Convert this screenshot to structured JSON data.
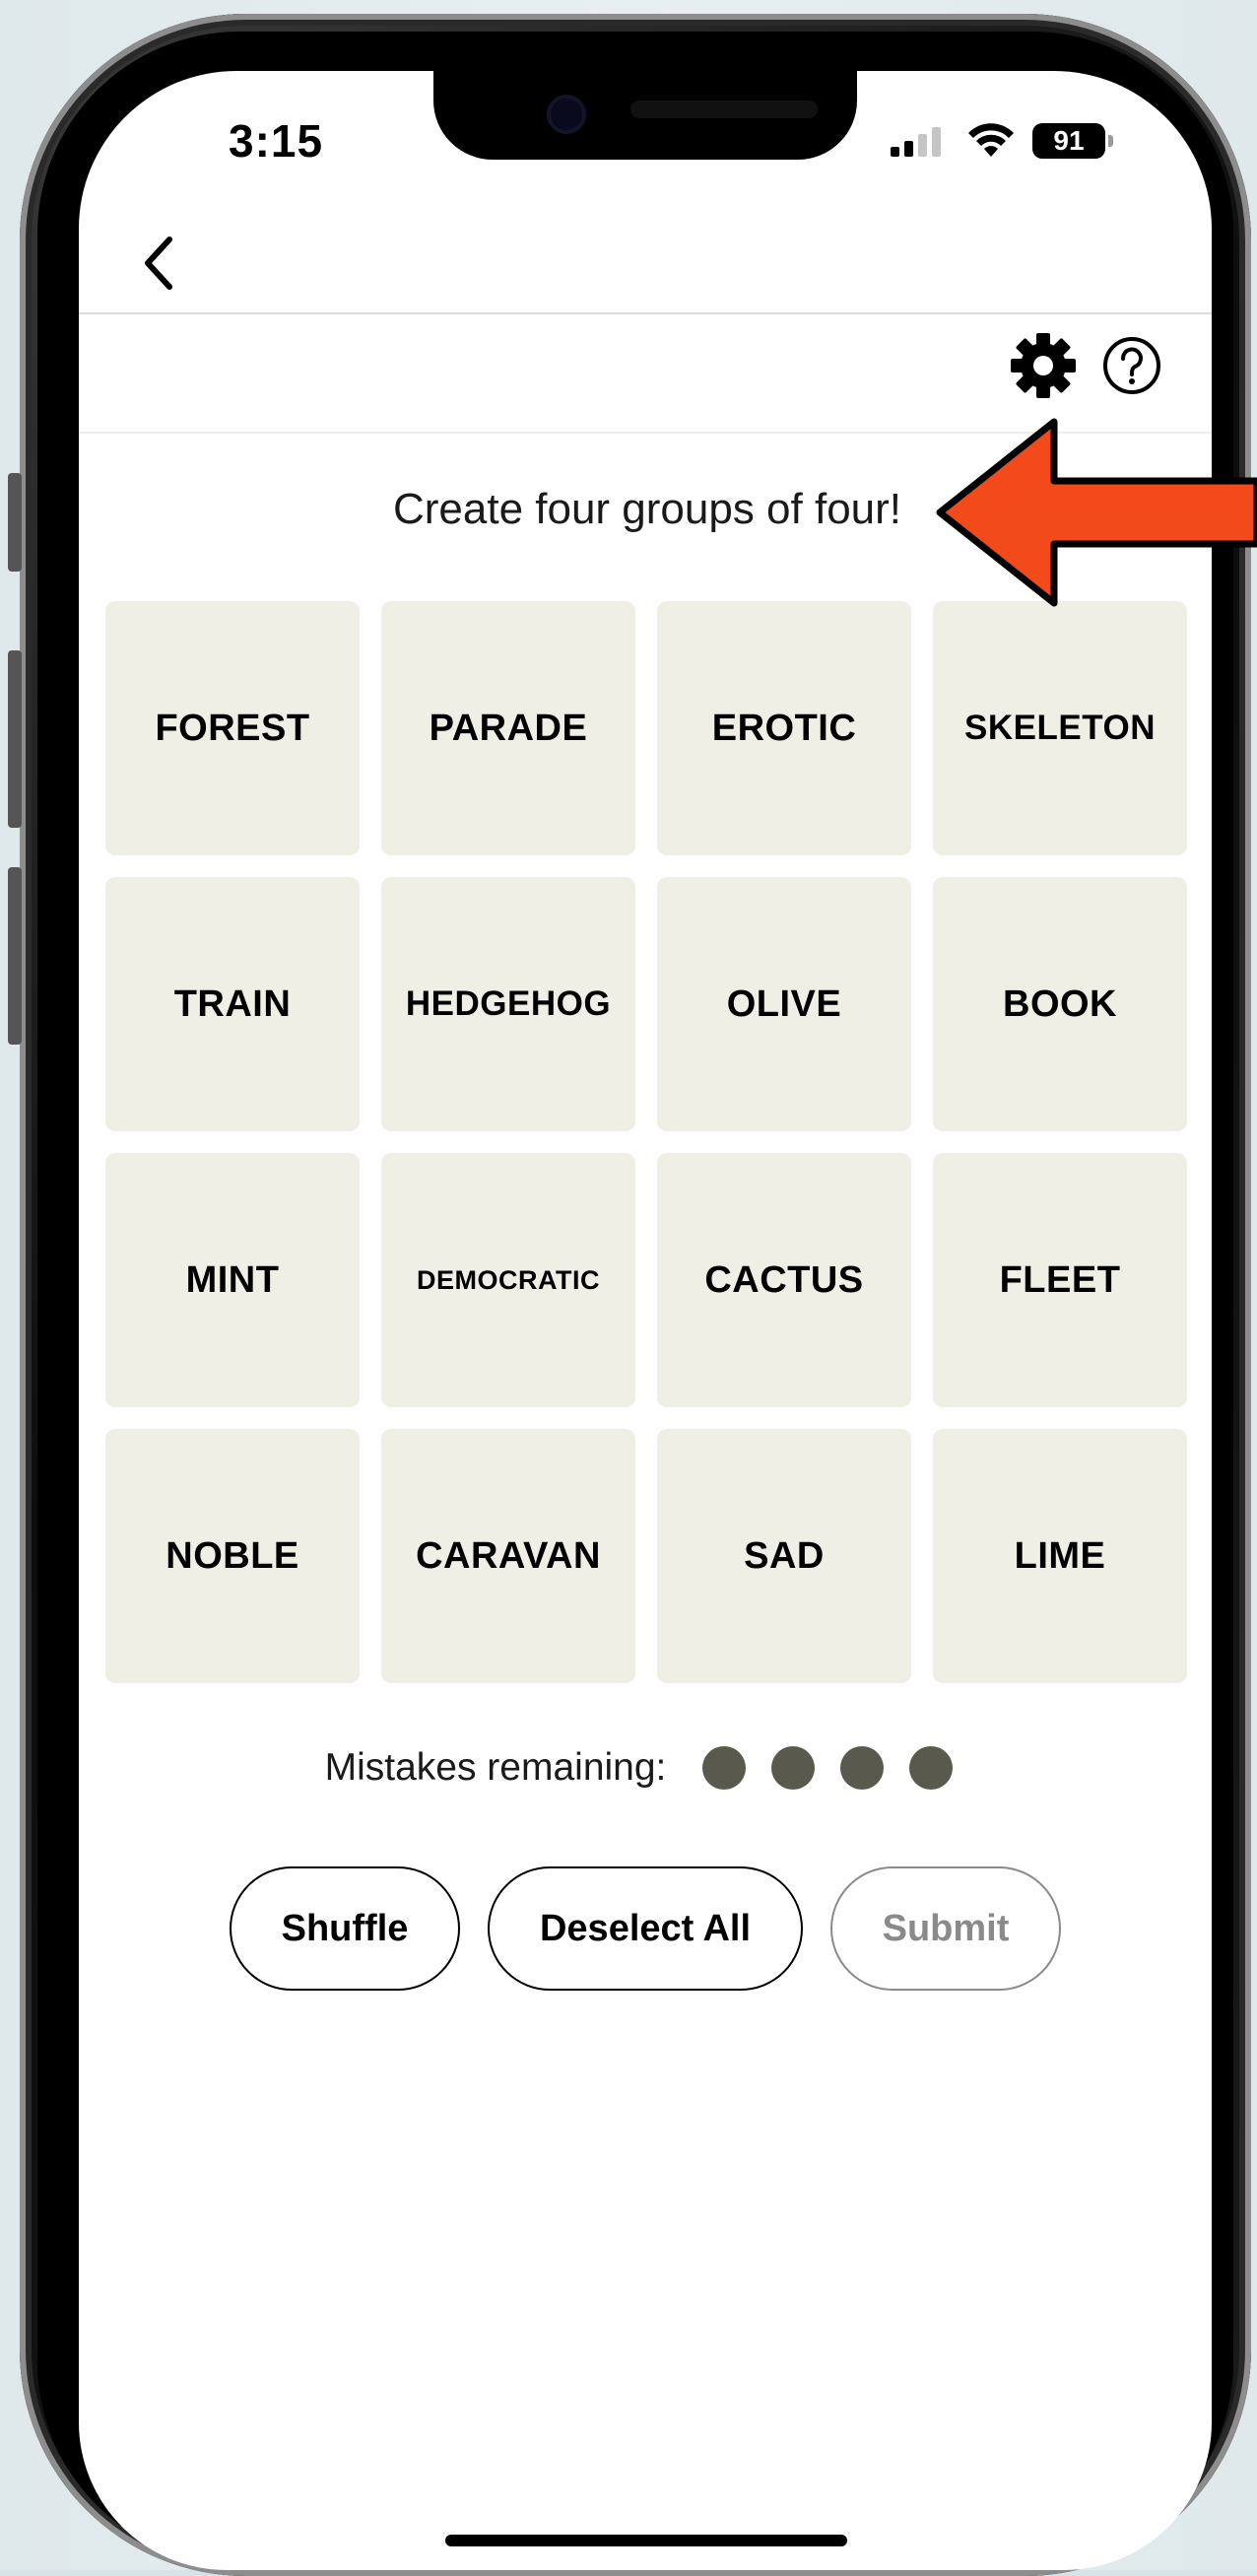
{
  "status_bar": {
    "time": "3:15",
    "battery": "91"
  },
  "nav": {
    "back_icon": "chevron-left-icon"
  },
  "toolbar": {
    "settings_icon": "gear-icon",
    "help_icon": "question-circle-icon"
  },
  "game": {
    "instructions": "Create four groups of four!",
    "tiles": [
      "FOREST",
      "PARADE",
      "EROTIC",
      "SKELETON",
      "TRAIN",
      "HEDGEHOG",
      "OLIVE",
      "BOOK",
      "MINT",
      "DEMOCRATIC",
      "CACTUS",
      "FLEET",
      "NOBLE",
      "CARAVAN",
      "SAD",
      "LIME"
    ],
    "mistakes_label": "Mistakes remaining:",
    "mistakes_remaining": 4
  },
  "actions": {
    "shuffle": "Shuffle",
    "deselect_all": "Deselect All",
    "submit": "Submit"
  },
  "colors": {
    "tile_bg": "#efefe6",
    "dot": "#5a594e",
    "annotation_arrow": "#f24a1b"
  }
}
